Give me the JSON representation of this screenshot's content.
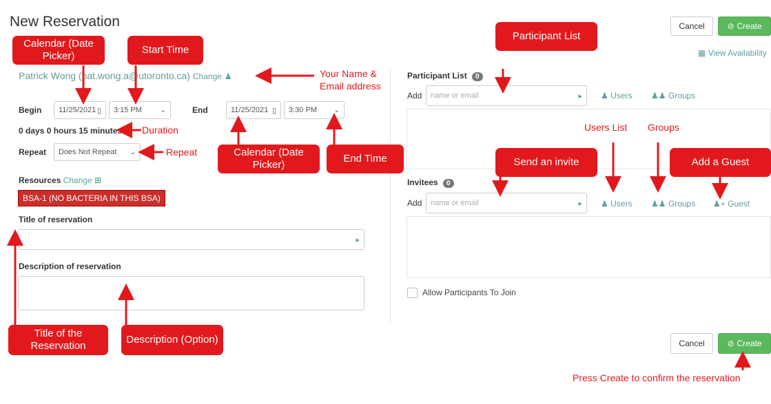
{
  "header": {
    "title": "New Reservation",
    "cancel": "Cancel",
    "create": "Create",
    "view_availability": "View Availability"
  },
  "owner": {
    "name": "Patrick Wong",
    "email": "(pat.wong.a@utoronto.ca)",
    "change": "Change"
  },
  "schedule": {
    "begin_label": "Begin",
    "begin_date": "11/25/2021",
    "begin_time": "3:15 PM",
    "end_label": "End",
    "end_date": "11/25/2021",
    "end_time": "3:30 PM",
    "duration": "0 days 0 hours 15 minutes",
    "repeat_label": "Repeat",
    "repeat_value": "Does Not Repeat"
  },
  "resources": {
    "label": "Resources",
    "change": "Change",
    "item": "BSA-1 (NO BACTERIA IN THIS BSA)"
  },
  "title_field": {
    "label": "Title of reservation"
  },
  "description_field": {
    "label": "Description of reservation"
  },
  "participants": {
    "label": "Participant List",
    "count": "0",
    "add": "Add",
    "placeholder": "name or email",
    "users": "Users",
    "groups": "Groups"
  },
  "invitees": {
    "label": "Invitees",
    "count": "0",
    "add": "Add",
    "placeholder": "name or email",
    "users": "Users",
    "groups": "Groups",
    "guest": "Guest"
  },
  "allow_join": "Allow Participants To Join",
  "footer": {
    "cancel": "Cancel",
    "create": "Create"
  },
  "annotations": {
    "calendar1": "Calendar (Date Picker)",
    "start_time": "Start Time",
    "your_name": "Your Name & Email address",
    "duration": "Duration",
    "repeat": "Repeat",
    "calendar2": "Calendar (Date Picker)",
    "end_time": "End Time",
    "participant_list": "Participant List",
    "users_list": "Users List",
    "groups": "Groups",
    "send_invite": "Send an invite",
    "add_guest": "Add a Guest",
    "title_of_reservation": "Title of the Reservation",
    "description": "Description (Option)",
    "press_create": "Press Create to confirm the reservation"
  },
  "colors": {
    "accent_red": "#e2191c",
    "success": "#5cb85c",
    "teal": "#5f9ea0"
  }
}
